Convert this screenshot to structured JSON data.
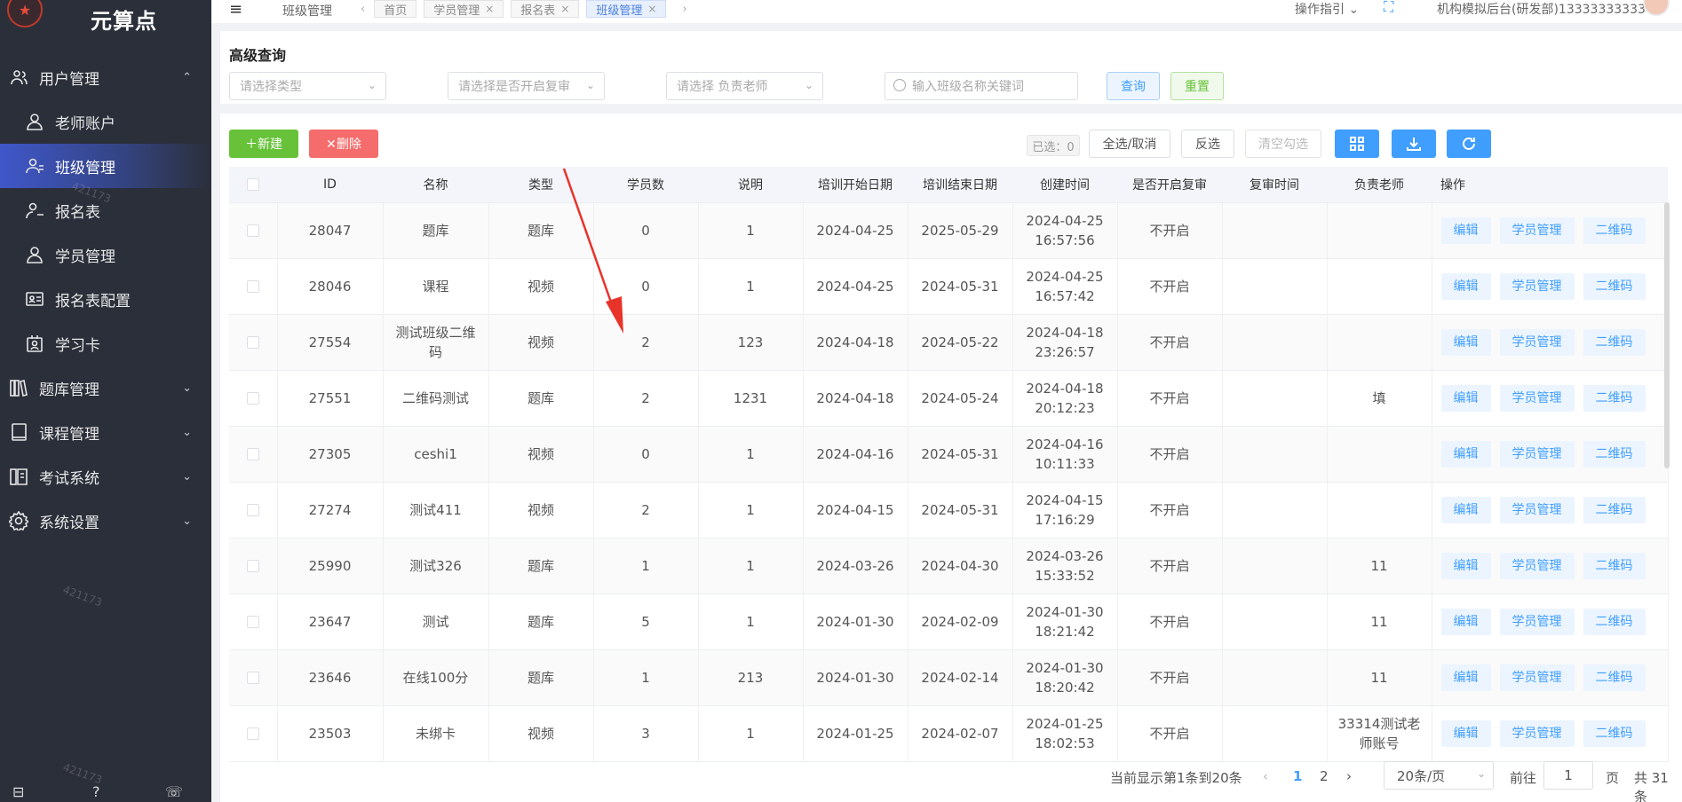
{
  "brand": {
    "name": "元算点",
    "logo_mark": "★"
  },
  "sidebar": {
    "items": [
      {
        "label": "用户管理",
        "icon": "users-icon",
        "level": "top",
        "arrow": "⌃"
      },
      {
        "label": "老师账户",
        "icon": "user-icon",
        "level": "sub"
      },
      {
        "label": "班级管理",
        "icon": "group-icon",
        "level": "sub",
        "active": true
      },
      {
        "label": "报名表",
        "icon": "user-minus-icon",
        "level": "sub"
      },
      {
        "label": "学员管理",
        "icon": "user-icon",
        "level": "sub"
      },
      {
        "label": "报名表配置",
        "icon": "id-card-icon",
        "level": "sub"
      },
      {
        "label": "学习卡",
        "icon": "badge-icon",
        "level": "sub"
      },
      {
        "label": "题库管理",
        "icon": "books-icon",
        "level": "top",
        "arrow": "⌄"
      },
      {
        "label": "课程管理",
        "icon": "book-icon",
        "level": "top",
        "arrow": "⌄"
      },
      {
        "label": "考试系统",
        "icon": "exam-icon",
        "level": "top",
        "arrow": "⌄"
      },
      {
        "label": "系统设置",
        "icon": "gear-icon",
        "level": "top",
        "arrow": "⌄"
      }
    ],
    "watermark": "421173"
  },
  "topbar": {
    "breadcrumb": "班级管理",
    "tabs": [
      {
        "label": "首页",
        "closable": false
      },
      {
        "label": "学员管理",
        "closable": true
      },
      {
        "label": "报名表",
        "closable": true
      },
      {
        "label": "班级管理",
        "closable": true,
        "active": true
      }
    ],
    "guide": "操作指引",
    "user": "机构模拟后台(研发部)13333333333"
  },
  "query": {
    "title": "高级查询",
    "type_placeholder": "请选择类型",
    "review_placeholder": "请选择是否开启复审",
    "teacher_placeholder": "请选择 负责老师",
    "search_placeholder": "输入班级名称关键词",
    "search_label": "查询",
    "reset_label": "重置"
  },
  "toolbar": {
    "new_label": "＋新建",
    "delete_label": "✕删除",
    "selected_count": "已选：0",
    "select_all": "全选/取消",
    "invert": "反选",
    "clear": "清空勾选"
  },
  "table": {
    "headers": [
      "ID",
      "名称",
      "类型",
      "学员数",
      "说明",
      "培训开始日期",
      "培训结束日期",
      "创建时间",
      "是否开启复审",
      "复审时间",
      "负责老师",
      "操作"
    ],
    "ops": [
      "编辑",
      "学员管理",
      "二维码"
    ],
    "rows": [
      {
        "id": "28047",
        "name": "题库",
        "type": "题库",
        "students": "0",
        "desc": "1",
        "start": "2024-04-25",
        "end": "2025-05-29",
        "created": "2024-04-25 16:57:56",
        "review": "不开启",
        "review_time": "",
        "teacher": ""
      },
      {
        "id": "28046",
        "name": "课程",
        "type": "视频",
        "students": "0",
        "desc": "1",
        "start": "2024-04-25",
        "end": "2024-05-31",
        "created": "2024-04-25 16:57:42",
        "review": "不开启",
        "review_time": "",
        "teacher": ""
      },
      {
        "id": "27554",
        "name": "测试班级二维码",
        "type": "视频",
        "students": "2",
        "desc": "123",
        "start": "2024-04-18",
        "end": "2024-05-22",
        "created": "2024-04-18 23:26:57",
        "review": "不开启",
        "review_time": "",
        "teacher": ""
      },
      {
        "id": "27551",
        "name": "二维码测试",
        "type": "题库",
        "students": "2",
        "desc": "1231",
        "start": "2024-04-18",
        "end": "2024-05-24",
        "created": "2024-04-18 20:12:23",
        "review": "不开启",
        "review_time": "",
        "teacher": "填"
      },
      {
        "id": "27305",
        "name": "ceshi1",
        "type": "视频",
        "students": "0",
        "desc": "1",
        "start": "2024-04-16",
        "end": "2024-05-31",
        "created": "2024-04-16 10:11:33",
        "review": "不开启",
        "review_time": "",
        "teacher": ""
      },
      {
        "id": "27274",
        "name": "测试411",
        "type": "视频",
        "students": "2",
        "desc": "1",
        "start": "2024-04-15",
        "end": "2024-05-31",
        "created": "2024-04-15 17:16:29",
        "review": "不开启",
        "review_time": "",
        "teacher": ""
      },
      {
        "id": "25990",
        "name": "测试326",
        "type": "题库",
        "students": "1",
        "desc": "1",
        "start": "2024-03-26",
        "end": "2024-04-30",
        "created": "2024-03-26 15:33:52",
        "review": "不开启",
        "review_time": "",
        "teacher": "11"
      },
      {
        "id": "23647",
        "name": "测试",
        "type": "题库",
        "students": "5",
        "desc": "1",
        "start": "2024-01-30",
        "end": "2024-02-09",
        "created": "2024-01-30 18:21:42",
        "review": "不开启",
        "review_time": "",
        "teacher": "11"
      },
      {
        "id": "23646",
        "name": "在线100分",
        "type": "题库",
        "students": "1",
        "desc": "213",
        "start": "2024-01-30",
        "end": "2024-02-14",
        "created": "2024-01-30 18:20:42",
        "review": "不开启",
        "review_time": "",
        "teacher": "11"
      },
      {
        "id": "23503",
        "name": "未绑卡",
        "type": "视频",
        "students": "3",
        "desc": "1",
        "start": "2024-01-25",
        "end": "2024-02-07",
        "created": "2024-01-25 18:02:53",
        "review": "不开启",
        "review_time": "",
        "teacher": "33314测试老师账号"
      }
    ]
  },
  "pager": {
    "summary": "当前显示第1条到20条",
    "pages": [
      "1",
      "2"
    ],
    "current": "1",
    "page_size": "20条/页",
    "goto_label": "前往",
    "goto_value": "1",
    "page_unit": "页",
    "total": "共 31 条"
  },
  "colors": {
    "accent": "#409eff",
    "sidebar_bg": "#2b2f3a",
    "new": "#67c23a",
    "delete": "#f56c6c",
    "annotation_arrow": "#e8332a"
  }
}
